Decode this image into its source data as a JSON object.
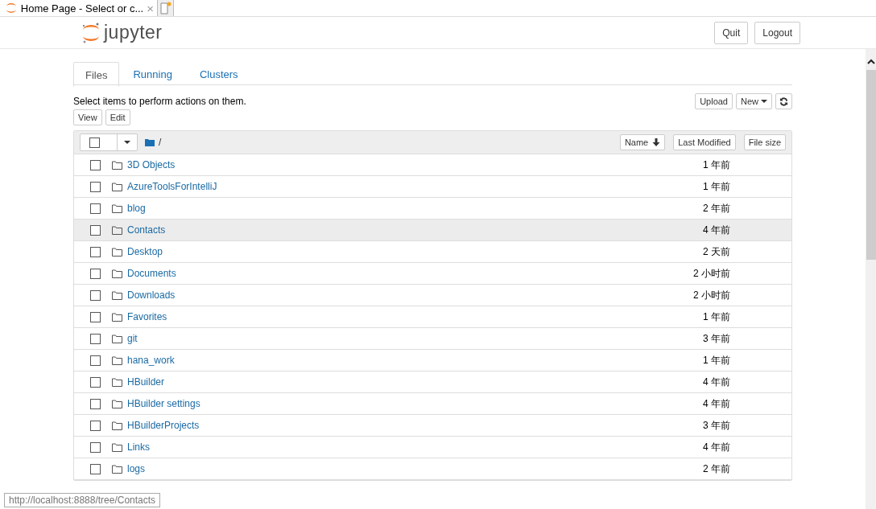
{
  "browser": {
    "tab_title": "Home Page - Select or c...",
    "close": "×"
  },
  "header": {
    "logo_text": "jupyter",
    "buttons": [
      "Quit",
      "Logout"
    ]
  },
  "tabs": [
    {
      "label": "Files",
      "selected": true
    },
    {
      "label": "Running",
      "selected": false
    },
    {
      "label": "Clusters",
      "selected": false
    }
  ],
  "instructions": "Select items to perform actions on them.",
  "actions": [
    "View",
    "Edit"
  ],
  "toolbar": {
    "upload": "Upload",
    "new": "New"
  },
  "select_all": {
    "checked": false
  },
  "breadcrumb": "/",
  "sort_buttons": [
    {
      "label": "Name",
      "sorted": true
    },
    {
      "label": "Last Modified",
      "sorted": false
    },
    {
      "label": "File size",
      "sorted": false
    }
  ],
  "rows": [
    {
      "name": "3D Objects",
      "modified": "1 年前",
      "hovered": false,
      "checked": false
    },
    {
      "name": "AzureToolsForIntelliJ",
      "modified": "1 年前",
      "hovered": false,
      "checked": false
    },
    {
      "name": "blog",
      "modified": "2 年前",
      "hovered": false,
      "checked": false
    },
    {
      "name": "Contacts",
      "modified": "4 年前",
      "hovered": true,
      "checked": false
    },
    {
      "name": "Desktop",
      "modified": "2 天前",
      "hovered": false,
      "checked": false
    },
    {
      "name": "Documents",
      "modified": "2 小时前",
      "hovered": false,
      "checked": false
    },
    {
      "name": "Downloads",
      "modified": "2 小时前",
      "hovered": false,
      "checked": false
    },
    {
      "name": "Favorites",
      "modified": "1 年前",
      "hovered": false,
      "checked": false
    },
    {
      "name": "git",
      "modified": "3 年前",
      "hovered": false,
      "checked": false
    },
    {
      "name": "hana_work",
      "modified": "1 年前",
      "hovered": false,
      "checked": false
    },
    {
      "name": "HBuilder",
      "modified": "4 年前",
      "hovered": false,
      "checked": false
    },
    {
      "name": "HBuilder settings",
      "modified": "4 年前",
      "hovered": false,
      "checked": false
    },
    {
      "name": "HBuilderProjects",
      "modified": "3 年前",
      "hovered": false,
      "checked": false
    },
    {
      "name": "Links",
      "modified": "4 年前",
      "hovered": false,
      "checked": false
    },
    {
      "name": "logs",
      "modified": "2 年前",
      "hovered": false,
      "checked": false
    }
  ],
  "status_url": "http://localhost:8888/tree/Contacts"
}
